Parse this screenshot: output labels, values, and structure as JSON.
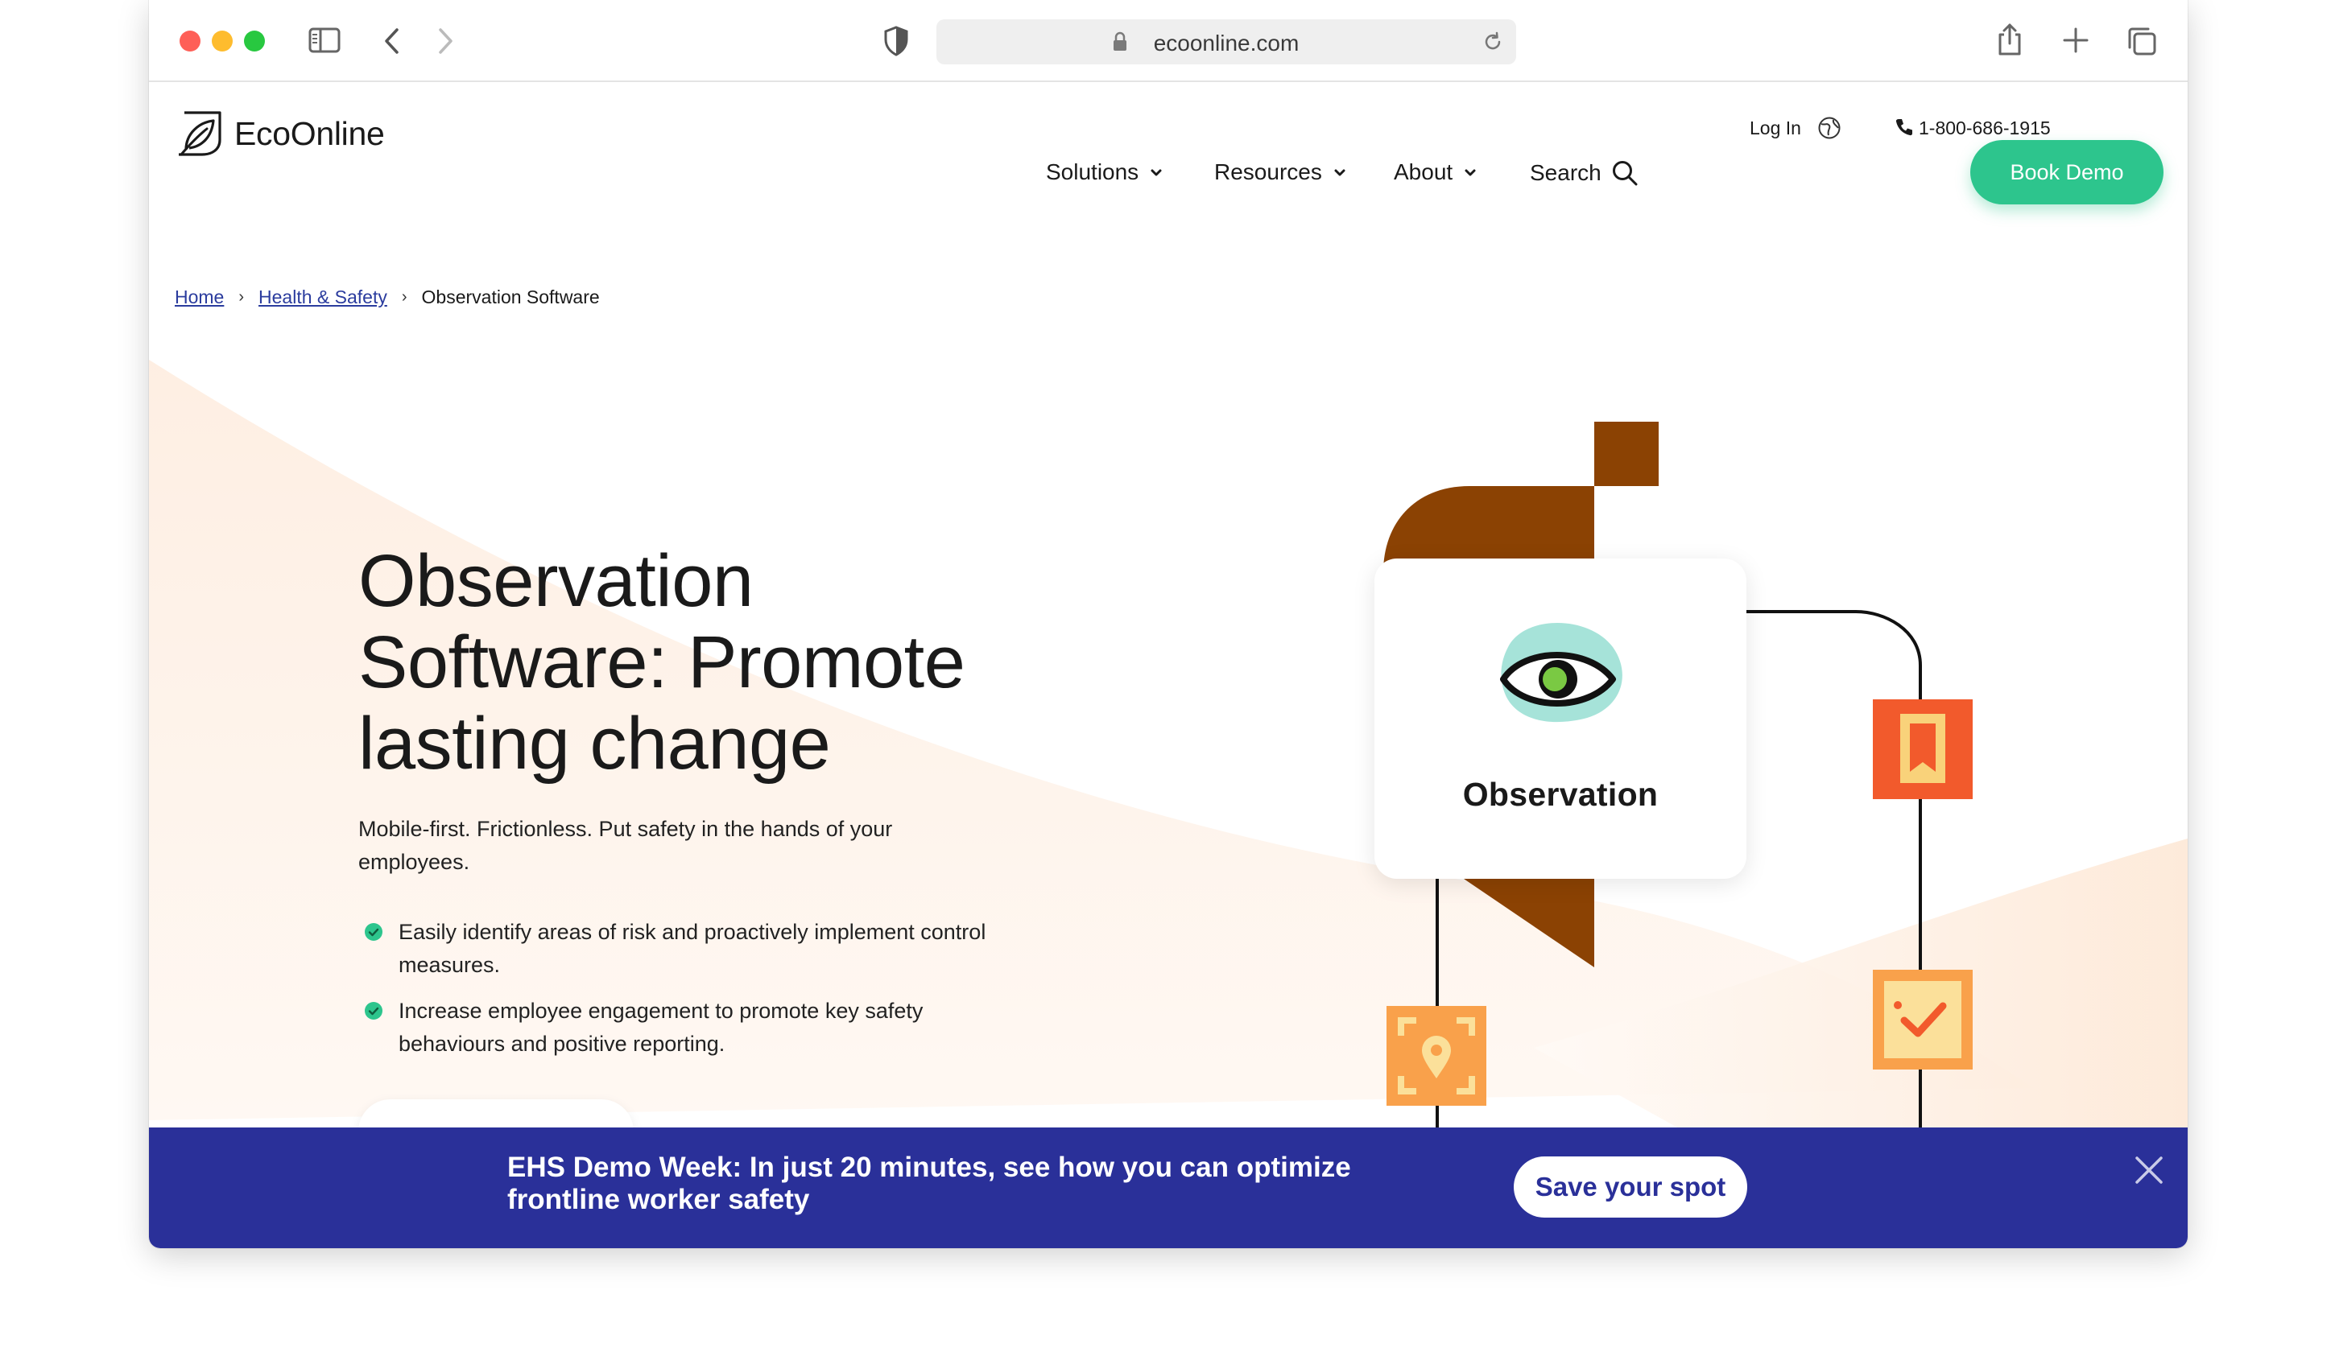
{
  "browser": {
    "url": "ecoonline.com"
  },
  "header": {
    "logo_text": "EcoOnline",
    "login_label": "Log In",
    "phone": "1-800-686-1915",
    "book_demo_label": "Book Demo",
    "nav": [
      {
        "label": "Solutions"
      },
      {
        "label": "Resources"
      },
      {
        "label": "About"
      },
      {
        "label": "Search"
      }
    ]
  },
  "breadcrumb": {
    "home": "Home",
    "section": "Health & Safety",
    "current": "Observation Software"
  },
  "hero": {
    "title_line1": "Observation",
    "title_line2": "Software: Promote",
    "title_line3": "lasting change",
    "subtitle": "Mobile-first. Frictionless. Put safety in the hands of your employees.",
    "bullets": [
      "Easily identify areas of risk and proactively implement control measures.",
      "Increase employee engagement to promote key safety behaviours and positive reporting."
    ]
  },
  "illustration": {
    "card_label": "Observation"
  },
  "banner": {
    "text": "EHS Demo Week: In just 20 minutes, see how you can optimize frontline worker safety",
    "cta_label": "Save your spot"
  },
  "colors": {
    "accent_green": "#2dc58d",
    "banner_blue": "#2a3099",
    "link_blue": "#2b3c9e",
    "brown": "#8b4203",
    "orange_red": "#f25a2c",
    "orange": "#f9a14b"
  }
}
